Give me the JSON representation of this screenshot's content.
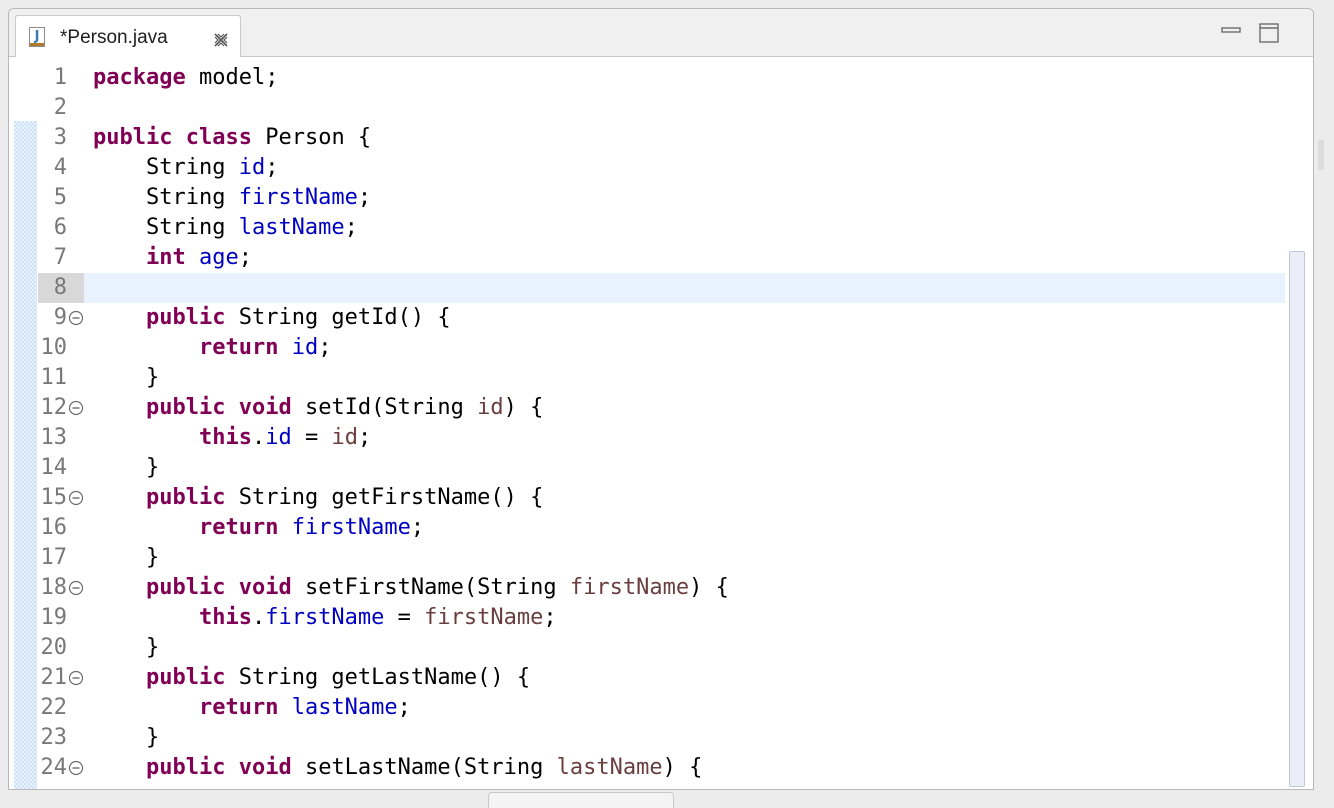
{
  "editor": {
    "tab": {
      "title": "*Person.java",
      "icon": "java-file-icon",
      "close_icon": "close-icon"
    },
    "window_controls": {
      "minimize_icon": "minimize-icon",
      "maximize_icon": "maximize-icon"
    },
    "current_line": 8,
    "colors": {
      "keyword": "#7f0055",
      "field": "#0000c0",
      "parameter": "#6a3e3e",
      "plain": "#000000",
      "line_number": "#787878",
      "current_line_bg": "#e8f2fe",
      "change_bar": "#cfe3f7"
    },
    "lines": [
      {
        "n": "1",
        "fold": false,
        "tokens": [
          {
            "t": "kw",
            "v": "package"
          },
          {
            "t": "plain",
            "v": " model;"
          }
        ]
      },
      {
        "n": "2",
        "fold": false,
        "tokens": []
      },
      {
        "n": "3",
        "fold": false,
        "tokens": [
          {
            "t": "kw",
            "v": "public"
          },
          {
            "t": "plain",
            "v": " "
          },
          {
            "t": "kw",
            "v": "class"
          },
          {
            "t": "plain",
            "v": " Person {"
          }
        ]
      },
      {
        "n": "4",
        "fold": false,
        "tokens": [
          {
            "t": "plain",
            "v": "    String "
          },
          {
            "t": "field",
            "v": "id"
          },
          {
            "t": "plain",
            "v": ";"
          }
        ]
      },
      {
        "n": "5",
        "fold": false,
        "tokens": [
          {
            "t": "plain",
            "v": "    String "
          },
          {
            "t": "field",
            "v": "firstName"
          },
          {
            "t": "plain",
            "v": ";"
          }
        ]
      },
      {
        "n": "6",
        "fold": false,
        "tokens": [
          {
            "t": "plain",
            "v": "    String "
          },
          {
            "t": "field",
            "v": "lastName"
          },
          {
            "t": "plain",
            "v": ";"
          }
        ]
      },
      {
        "n": "7",
        "fold": false,
        "tokens": [
          {
            "t": "plain",
            "v": "    "
          },
          {
            "t": "kw",
            "v": "int"
          },
          {
            "t": "plain",
            "v": " "
          },
          {
            "t": "field",
            "v": "age"
          },
          {
            "t": "plain",
            "v": ";"
          }
        ]
      },
      {
        "n": "8",
        "fold": false,
        "tokens": []
      },
      {
        "n": "9",
        "fold": true,
        "tokens": [
          {
            "t": "plain",
            "v": "    "
          },
          {
            "t": "kw",
            "v": "public"
          },
          {
            "t": "plain",
            "v": " String getId() {"
          }
        ]
      },
      {
        "n": "10",
        "fold": false,
        "tokens": [
          {
            "t": "plain",
            "v": "        "
          },
          {
            "t": "kw",
            "v": "return"
          },
          {
            "t": "plain",
            "v": " "
          },
          {
            "t": "field",
            "v": "id"
          },
          {
            "t": "plain",
            "v": ";"
          }
        ]
      },
      {
        "n": "11",
        "fold": false,
        "tokens": [
          {
            "t": "plain",
            "v": "    }"
          }
        ]
      },
      {
        "n": "12",
        "fold": true,
        "tokens": [
          {
            "t": "plain",
            "v": "    "
          },
          {
            "t": "kw",
            "v": "public"
          },
          {
            "t": "plain",
            "v": " "
          },
          {
            "t": "kw",
            "v": "void"
          },
          {
            "t": "plain",
            "v": " setId(String "
          },
          {
            "t": "param",
            "v": "id"
          },
          {
            "t": "plain",
            "v": ") {"
          }
        ]
      },
      {
        "n": "13",
        "fold": false,
        "tokens": [
          {
            "t": "plain",
            "v": "        "
          },
          {
            "t": "kw",
            "v": "this"
          },
          {
            "t": "plain",
            "v": "."
          },
          {
            "t": "field",
            "v": "id"
          },
          {
            "t": "plain",
            "v": " = "
          },
          {
            "t": "param",
            "v": "id"
          },
          {
            "t": "plain",
            "v": ";"
          }
        ]
      },
      {
        "n": "14",
        "fold": false,
        "tokens": [
          {
            "t": "plain",
            "v": "    }"
          }
        ]
      },
      {
        "n": "15",
        "fold": true,
        "tokens": [
          {
            "t": "plain",
            "v": "    "
          },
          {
            "t": "kw",
            "v": "public"
          },
          {
            "t": "plain",
            "v": " String getFirstName() {"
          }
        ]
      },
      {
        "n": "16",
        "fold": false,
        "tokens": [
          {
            "t": "plain",
            "v": "        "
          },
          {
            "t": "kw",
            "v": "return"
          },
          {
            "t": "plain",
            "v": " "
          },
          {
            "t": "field",
            "v": "firstName"
          },
          {
            "t": "plain",
            "v": ";"
          }
        ]
      },
      {
        "n": "17",
        "fold": false,
        "tokens": [
          {
            "t": "plain",
            "v": "    }"
          }
        ]
      },
      {
        "n": "18",
        "fold": true,
        "tokens": [
          {
            "t": "plain",
            "v": "    "
          },
          {
            "t": "kw",
            "v": "public"
          },
          {
            "t": "plain",
            "v": " "
          },
          {
            "t": "kw",
            "v": "void"
          },
          {
            "t": "plain",
            "v": " setFirstName(String "
          },
          {
            "t": "param",
            "v": "firstName"
          },
          {
            "t": "plain",
            "v": ") {"
          }
        ]
      },
      {
        "n": "19",
        "fold": false,
        "tokens": [
          {
            "t": "plain",
            "v": "        "
          },
          {
            "t": "kw",
            "v": "this"
          },
          {
            "t": "plain",
            "v": "."
          },
          {
            "t": "field",
            "v": "firstName"
          },
          {
            "t": "plain",
            "v": " = "
          },
          {
            "t": "param",
            "v": "firstName"
          },
          {
            "t": "plain",
            "v": ";"
          }
        ]
      },
      {
        "n": "20",
        "fold": false,
        "tokens": [
          {
            "t": "plain",
            "v": "    }"
          }
        ]
      },
      {
        "n": "21",
        "fold": true,
        "tokens": [
          {
            "t": "plain",
            "v": "    "
          },
          {
            "t": "kw",
            "v": "public"
          },
          {
            "t": "plain",
            "v": " String getLastName() {"
          }
        ]
      },
      {
        "n": "22",
        "fold": false,
        "tokens": [
          {
            "t": "plain",
            "v": "        "
          },
          {
            "t": "kw",
            "v": "return"
          },
          {
            "t": "plain",
            "v": " "
          },
          {
            "t": "field",
            "v": "lastName"
          },
          {
            "t": "plain",
            "v": ";"
          }
        ]
      },
      {
        "n": "23",
        "fold": false,
        "tokens": [
          {
            "t": "plain",
            "v": "    }"
          }
        ]
      },
      {
        "n": "24",
        "fold": true,
        "tokens": [
          {
            "t": "plain",
            "v": "    "
          },
          {
            "t": "kw",
            "v": "public"
          },
          {
            "t": "plain",
            "v": " "
          },
          {
            "t": "kw",
            "v": "void"
          },
          {
            "t": "plain",
            "v": " setLastName(String "
          },
          {
            "t": "param",
            "v": "lastName"
          },
          {
            "t": "plain",
            "v": ") {"
          }
        ]
      }
    ]
  }
}
